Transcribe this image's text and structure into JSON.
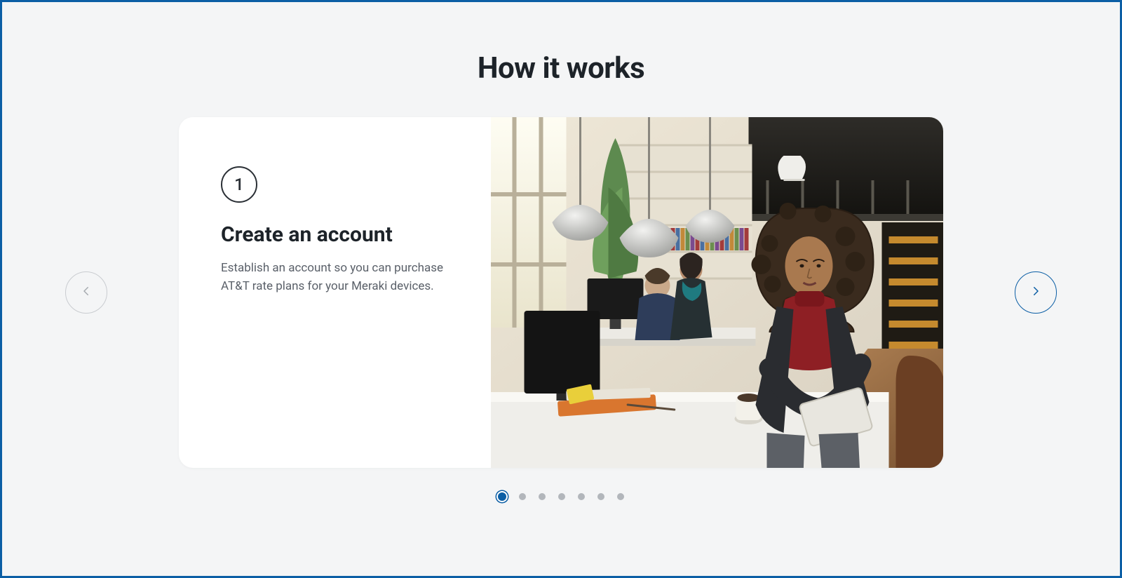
{
  "section": {
    "title": "How it works"
  },
  "slide": {
    "step_number": "1",
    "title": "Create an account",
    "description": "Establish an account so you can purchase AT&T rate plans for your Meraki devices.",
    "image_alt": "Woman in modern open office holding a tablet, coworkers at desks behind her"
  },
  "carousel": {
    "total_slides": 7,
    "active_index": 0
  },
  "colors": {
    "accent": "#0b5ea5",
    "text_primary": "#1d2329",
    "text_secondary": "#5a6069",
    "surface": "#ffffff",
    "page_bg": "#f4f5f6",
    "inactive": "#b2b6bb",
    "disabled_border": "#c9ccd0"
  }
}
